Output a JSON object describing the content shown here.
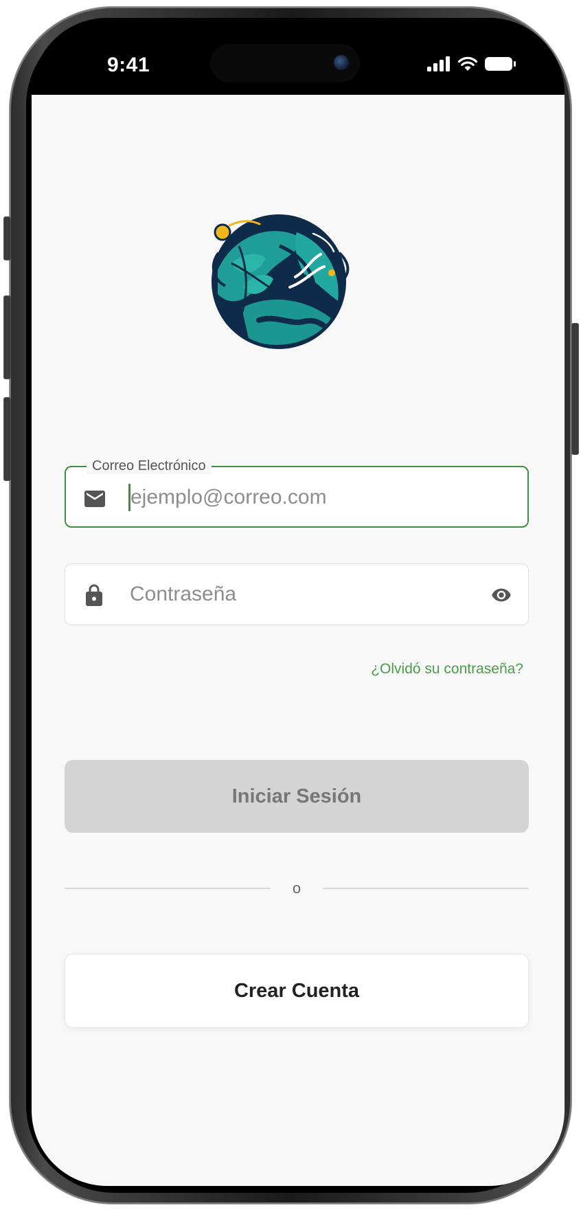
{
  "status_bar": {
    "time": "9:41"
  },
  "login": {
    "logo_icon": "earth-leaves-logo-icon",
    "email": {
      "label": "Correo Electrónico",
      "placeholder": "ejemplo@correo.com",
      "value": "",
      "icon": "mail-icon"
    },
    "password": {
      "label": "",
      "placeholder": "Contraseña",
      "value": "",
      "icon": "lock-icon",
      "toggle_icon": "eye-icon"
    },
    "forgot_password": "¿Olvidó su contraseña?",
    "sign_in_button": "Iniciar Sesión",
    "divider_text": "o",
    "create_account_button": "Crear Cuenta"
  },
  "colors": {
    "accent_green": "#3f8d3f",
    "link_green": "#4a9d4a",
    "disabled_button": "#d4d4d4",
    "background": "#f8f8f8",
    "logo_navy": "#0f2b4a",
    "logo_teal": "#1f9e97",
    "logo_gold": "#f2b51a"
  }
}
